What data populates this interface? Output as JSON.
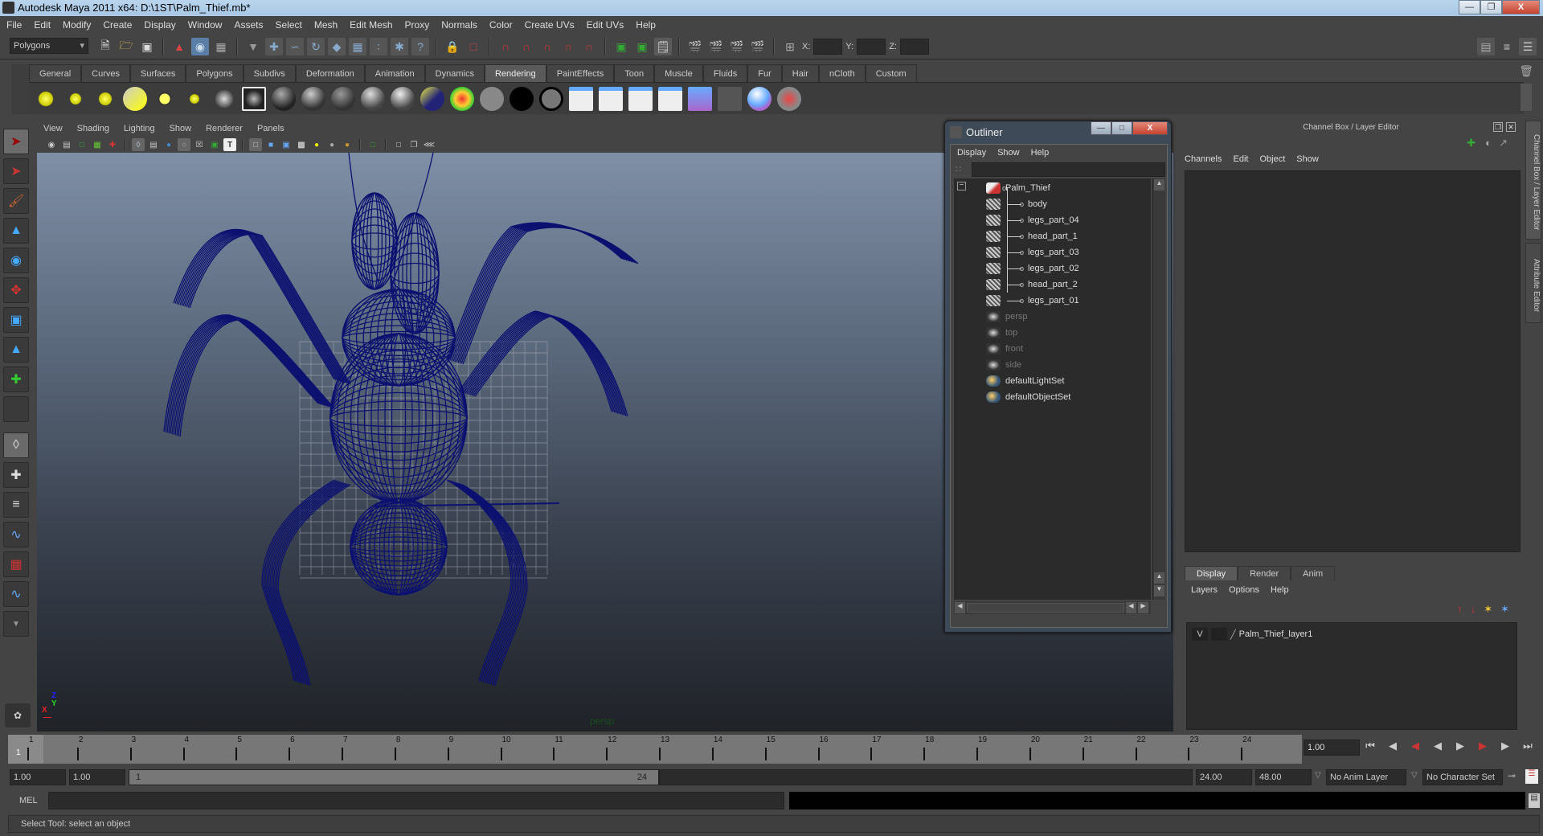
{
  "window": {
    "title": "Autodesk Maya 2011 x64: D:\\1ST\\Palm_Thief.mb*",
    "controls": [
      "minimize",
      "maximize",
      "close"
    ]
  },
  "menubar": [
    "File",
    "Edit",
    "Modify",
    "Create",
    "Display",
    "Window",
    "Assets",
    "Select",
    "Mesh",
    "Edit Mesh",
    "Proxy",
    "Normals",
    "Color",
    "Create UVs",
    "Edit UVs",
    "Help"
  ],
  "statusline": {
    "menuset": "Polygons",
    "x_label": "X:",
    "y_label": "Y:",
    "z_label": "Z:",
    "x_value": "",
    "y_value": "",
    "z_value": ""
  },
  "shelf": {
    "tabs": [
      "General",
      "Curves",
      "Surfaces",
      "Polygons",
      "Subdivs",
      "Deformation",
      "Animation",
      "Dynamics",
      "Rendering",
      "PaintEffects",
      "Toon",
      "Muscle",
      "Fluids",
      "Fur",
      "Hair",
      "nCloth",
      "Custom"
    ],
    "active_tab": "Rendering",
    "icons": [
      "ambient-light",
      "directional-light",
      "point-light",
      "spot-light",
      "area-light",
      "volume-light",
      "camera",
      "env-ball",
      "blinn",
      "lambert",
      "phong",
      "phongE",
      "anisotropic",
      "layered-shader",
      "ramp-shader",
      "surface-gray",
      "surface-black",
      "surface-outline",
      "render-view",
      "ipr-render",
      "batch-render",
      "render-settings",
      "hypershade",
      "no-light",
      "attach-material",
      "paint-fx"
    ]
  },
  "toolbox": [
    "select-tool",
    "lasso-tool",
    "paint-select-tool",
    "move-tool",
    "rotate-tool",
    "scale-tool",
    "universal-manipulator",
    "soft-modification-tool",
    "show-manipulator",
    "last-tool",
    "single-perspective-layout",
    "four-view-layout",
    "persp-outliner-layout",
    "persp-graph-layout",
    "persp-hypershade-layout",
    "persp-graph-outliner-layout",
    "more-layouts"
  ],
  "viewport": {
    "menu": [
      "View",
      "Shading",
      "Lighting",
      "Show",
      "Renderer",
      "Panels"
    ],
    "camera_label": "persp",
    "axis_labels": {
      "x": "X",
      "y": "Y",
      "z": "Z"
    },
    "wire_color": "#0c1170"
  },
  "outliner": {
    "title": "Outliner",
    "menu": [
      "Display",
      "Show",
      "Help"
    ],
    "filter_value": "",
    "items": [
      {
        "label": "Palm_Thief",
        "type": "group",
        "indent": 0,
        "dim": false
      },
      {
        "label": "body",
        "type": "mesh",
        "indent": 1,
        "dim": false
      },
      {
        "label": "legs_part_04",
        "type": "mesh",
        "indent": 1,
        "dim": false
      },
      {
        "label": "head_part_1",
        "type": "mesh",
        "indent": 1,
        "dim": false
      },
      {
        "label": "legs_part_03",
        "type": "mesh",
        "indent": 1,
        "dim": false
      },
      {
        "label": "legs_part_02",
        "type": "mesh",
        "indent": 1,
        "dim": false
      },
      {
        "label": "head_part_2",
        "type": "mesh",
        "indent": 1,
        "dim": false
      },
      {
        "label": "legs_part_01",
        "type": "mesh",
        "indent": 1,
        "dim": false
      },
      {
        "label": "persp",
        "type": "camera",
        "indent": 0,
        "dim": true
      },
      {
        "label": "top",
        "type": "camera",
        "indent": 0,
        "dim": true
      },
      {
        "label": "front",
        "type": "camera",
        "indent": 0,
        "dim": true
      },
      {
        "label": "side",
        "type": "camera",
        "indent": 0,
        "dim": true
      },
      {
        "label": "defaultLightSet",
        "type": "set",
        "indent": 0,
        "dim": false
      },
      {
        "label": "defaultObjectSet",
        "type": "set",
        "indent": 0,
        "dim": false
      }
    ]
  },
  "channel_box": {
    "title": "Channel Box / Layer Editor",
    "menu": [
      "Channels",
      "Edit",
      "Object",
      "Show"
    ]
  },
  "side_tabs": [
    "Channel Box / Layer Editor",
    "Attribute Editor"
  ],
  "layer_editor": {
    "tabs": [
      "Display",
      "Render",
      "Anim"
    ],
    "active_tab": "Display",
    "menu": [
      "Layers",
      "Options",
      "Help"
    ],
    "layers": [
      {
        "visible": "V",
        "name": "Palm_Thief_layer1"
      }
    ]
  },
  "timeline": {
    "start": 1,
    "end": 24,
    "current_frame_marker": "1",
    "current_time": "1.00",
    "ticks": [
      "1",
      "2",
      "3",
      "4",
      "5",
      "6",
      "7",
      "8",
      "9",
      "10",
      "11",
      "12",
      "13",
      "14",
      "15",
      "16",
      "17",
      "18",
      "19",
      "20",
      "21",
      "22",
      "23",
      "24"
    ],
    "playback": [
      "go-to-start",
      "step-back-key",
      "step-back-frame",
      "play-backward",
      "play-forward",
      "step-forward-frame",
      "step-forward-key",
      "go-to-end"
    ]
  },
  "range": {
    "start_time": "1.00",
    "playback_start": "1.00",
    "slider_start": "1",
    "slider_end": "24",
    "playback_end": "24.00",
    "end_time": "48.00",
    "anim_layer": "No Anim Layer",
    "character_set": "No Character Set"
  },
  "command_line": {
    "label": "MEL",
    "value": "",
    "result": ""
  },
  "help_line": "Select Tool: select an object"
}
